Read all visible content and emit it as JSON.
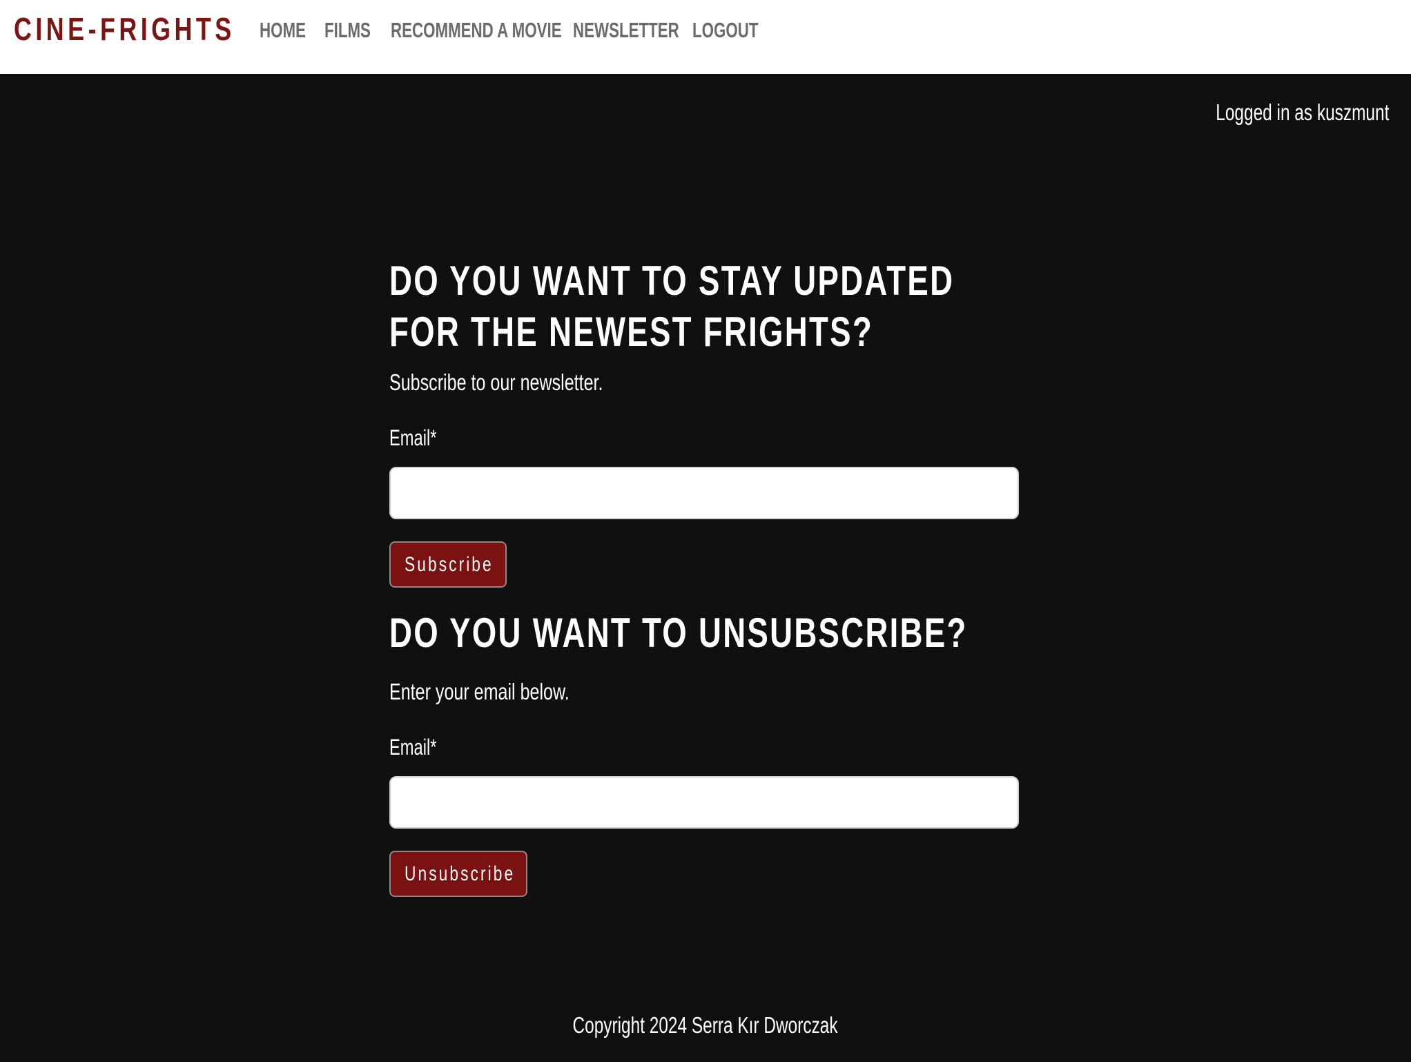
{
  "navbar": {
    "brand": "CINE-FRIGHTS",
    "links": [
      "HOME",
      "FILMS",
      "RECOMMEND A MOVIE",
      "NEWSLETTER",
      "LOGOUT"
    ]
  },
  "status": {
    "logged_in": "Logged in as kuszmunt"
  },
  "subscribe": {
    "heading": "DO YOU WANT TO STAY UPDATED FOR THE NEWEST FRIGHTS?",
    "text": "Subscribe to our newsletter.",
    "email_label": "Email*",
    "email_value": "",
    "button": "Subscribe"
  },
  "unsubscribe": {
    "heading": "DO YOU WANT TO UNSUBSCRIBE?",
    "text": "Enter your email below.",
    "email_label": "Email*",
    "email_value": "",
    "button": "Unsubscribe"
  },
  "footer": {
    "copyright": "Copyright 2024 Serra Kır Dworczak"
  },
  "colors": {
    "brand": "#7c1414",
    "background": "#101010",
    "button": "#7a1212",
    "nav_link": "#6b6b6b"
  }
}
